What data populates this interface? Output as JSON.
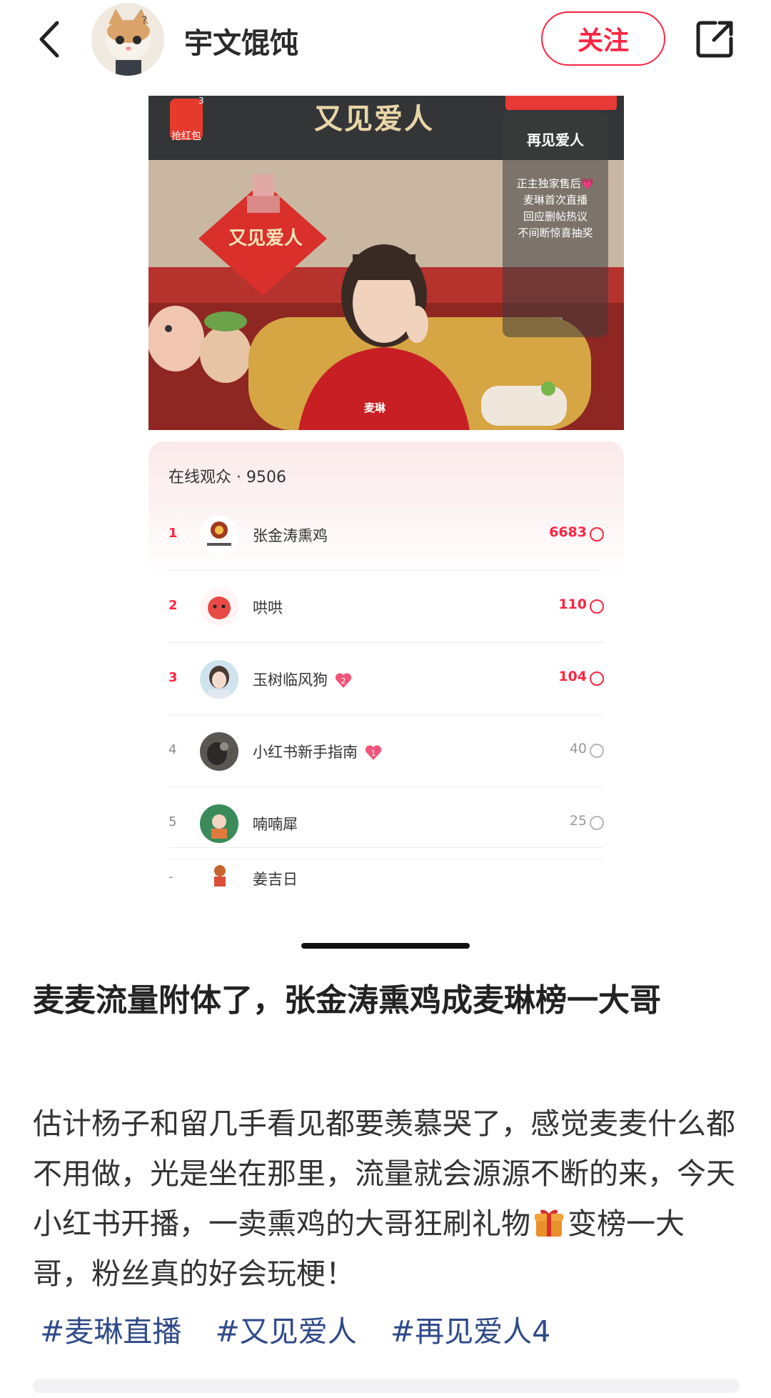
{
  "header": {
    "author_name": "宇文馄饨",
    "follow_label": "关注"
  },
  "live": {
    "title_art": "又见爱人",
    "redpack_label": "抢红包",
    "redpack_count": "3",
    "side_card": {
      "title": "再见爱人",
      "lines": [
        "正主独家售后💗",
        "麦琳首次直播",
        "回应删帖热议",
        "不间断惊喜抽奖"
      ]
    },
    "host_label": "麦琳",
    "audience_label": "在线观众 · 9506",
    "ranking": [
      {
        "rank": "1",
        "name": "张金涛熏鸡",
        "score": "6683",
        "badge": ""
      },
      {
        "rank": "2",
        "name": "哄哄",
        "score": "110",
        "badge": ""
      },
      {
        "rank": "3",
        "name": "玉树临风狗",
        "score": "104",
        "badge": "2"
      },
      {
        "rank": "4",
        "name": "小红书新手指南",
        "score": "40",
        "badge": "1"
      },
      {
        "rank": "5",
        "name": "喃喃犀",
        "score": "25",
        "badge": ""
      },
      {
        "rank": "-",
        "name": "姜吉日",
        "score": "",
        "badge": ""
      }
    ]
  },
  "post": {
    "title": "麦麦流量附体了，张金涛熏鸡成麦琳榜一大哥",
    "body_before_emoji": "估计杨子和留几手看见都要羡慕哭了，感觉麦麦什么都不用做，光是坐在那里，流量就会源源不断的来，今天小红书开播，一卖熏鸡的大哥狂刷礼物",
    "body_after_emoji": "变榜一大哥，粉丝真的好会玩梗！",
    "tags": [
      "#麦琳直播",
      "#又见爱人",
      "#再见爱人4"
    ]
  },
  "colors": {
    "accent": "#ff2442",
    "tag": "#2f4a8a"
  }
}
